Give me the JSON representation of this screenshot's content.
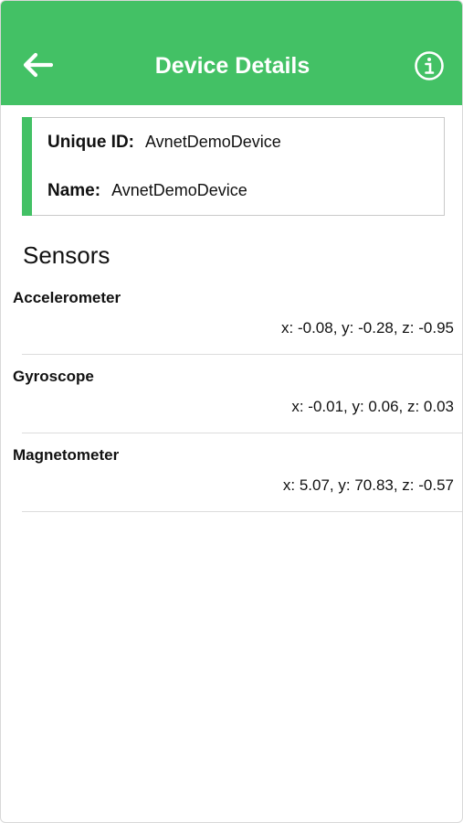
{
  "header": {
    "title": "Device Details",
    "back_icon": "arrow-left-icon",
    "info_icon": "info-circle-icon",
    "background_color": "#43c165"
  },
  "device": {
    "unique_id_label": "Unique ID:",
    "unique_id_value": "AvnetDemoDevice",
    "name_label": "Name:",
    "name_value": "AvnetDemoDevice"
  },
  "sensors": {
    "heading": "Sensors",
    "items": [
      {
        "name": "Accelerometer",
        "value": "x: -0.08, y: -0.28, z: -0.95"
      },
      {
        "name": "Gyroscope",
        "value": "x: -0.01, y: 0.06, z: 0.03"
      },
      {
        "name": "Magnetometer",
        "value": "x: 5.07, y: 70.83, z: -0.57"
      }
    ]
  }
}
